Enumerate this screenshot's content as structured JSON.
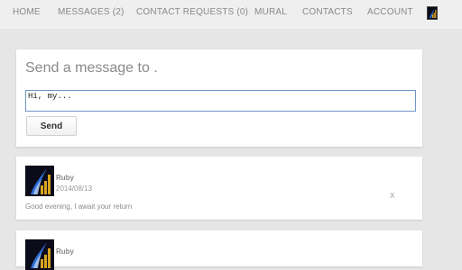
{
  "nav": {
    "items": [
      "HOME",
      "MESSAGES (2)",
      "CONTACT REQUESTS (0)",
      "MURAL",
      "CONTACTS",
      "ACCOUNT"
    ]
  },
  "compose": {
    "title": "Send a message to .",
    "input_value": "Hi, my...",
    "send_label": "Send"
  },
  "messages": [
    {
      "author": "Ruby",
      "date": "2014/08/13",
      "text": "Good evening, I await your return",
      "delete_label": "X"
    },
    {
      "author": "Ruby"
    }
  ],
  "colors": {
    "page_bg": "#e6e6e6",
    "nav_bg": "#efefef",
    "card_bg": "#ffffff",
    "input_border": "#6f95c6",
    "avatar_bg": "#0b0b1a",
    "avatar_bars": "#d9a520",
    "avatar_flame": "#2f6fd6"
  },
  "icons": {
    "nav_avatar": "profile-avatar-icon",
    "message_avatar": "profile-avatar-icon"
  }
}
